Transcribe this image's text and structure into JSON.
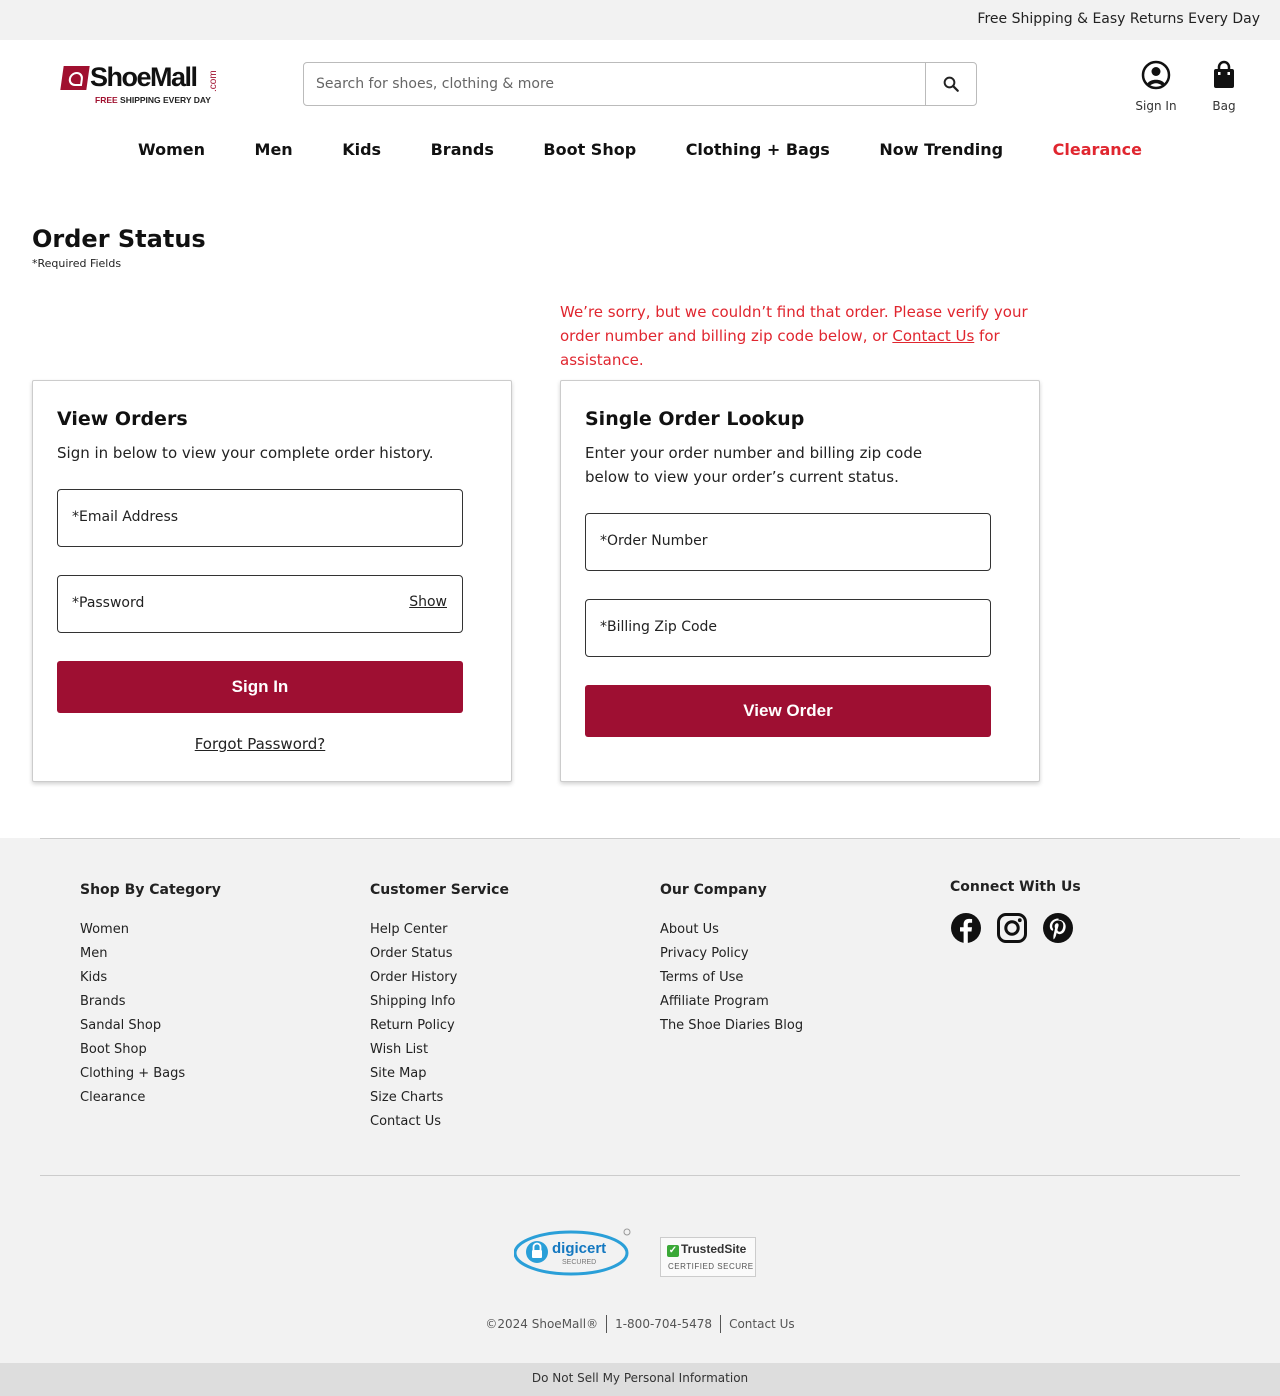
{
  "promo": {
    "text": "Free Shipping & Easy Returns Every Day"
  },
  "logo": {
    "word": "ShoeMall",
    "dotcom": ".com",
    "tag_free": "FREE",
    "tag_rest": " SHIPPING EVERY DAY"
  },
  "search": {
    "placeholder": "Search for shoes, clothing & more",
    "button_icon": "search-icon"
  },
  "header_icons": {
    "sign_in_label": "Sign In",
    "bag_label": "Bag"
  },
  "nav": {
    "items": [
      "Women",
      "Men",
      "Kids",
      "Brands",
      "Boot Shop",
      "Clothing + Bags",
      "Now Trending",
      "Clearance"
    ],
    "clearance_color": "#e0262f"
  },
  "page": {
    "title": "Order Status",
    "required_note": "*Required Fields"
  },
  "error": {
    "before": "We’re sorry, but we couldn’t find that order. Please verify your order number and billing zip code below, or ",
    "link": "Contact Us",
    "after": " for assistance."
  },
  "view_orders": {
    "title": "View Orders",
    "desc": "Sign in below to view your complete order history.",
    "email_label": "*Email Address",
    "password_label": "*Password",
    "show_label": "Show",
    "button": "Sign In",
    "forgot": "Forgot Password?"
  },
  "single_lookup": {
    "title": "Single Order Lookup",
    "desc": "Enter your order number and billing zip code below to view your order’s current status.",
    "order_label": "*Order Number",
    "zip_label": "*Billing Zip Code",
    "button": "View Order"
  },
  "colors": {
    "primary_button": "#9e0f32",
    "error": "#e0262f"
  },
  "footer": {
    "shop": {
      "heading": "Shop By Category",
      "links": [
        "Women",
        "Men",
        "Kids",
        "Brands",
        "Sandal Shop",
        "Boot Shop",
        "Clothing + Bags",
        "Clearance"
      ]
    },
    "service": {
      "heading": "Customer Service",
      "links": [
        "Help Center",
        "Order Status",
        "Order History",
        "Shipping Info",
        "Return Policy",
        "Wish List",
        "Site Map",
        "Size Charts",
        "Contact Us"
      ]
    },
    "company": {
      "heading": "Our Company",
      "links": [
        "About Us",
        "Privacy Policy",
        "Terms of Use",
        "Affiliate Program",
        "The Shoe Diaries Blog"
      ]
    },
    "connect": {
      "heading": "Connect With Us",
      "icons": [
        "facebook-icon",
        "instagram-icon",
        "pinterest-icon"
      ]
    },
    "badges": {
      "digicert_brand": "digicert",
      "digicert_sub": "SECURED",
      "trusted_title": "TrustedSite",
      "trusted_sub": "CERTIFIED SECURE"
    },
    "copyright": "©2024 ShoeMall®",
    "phone": "1-800-704-5478",
    "contact": "Contact Us",
    "do_not_sell": "Do Not Sell My Personal Information"
  }
}
